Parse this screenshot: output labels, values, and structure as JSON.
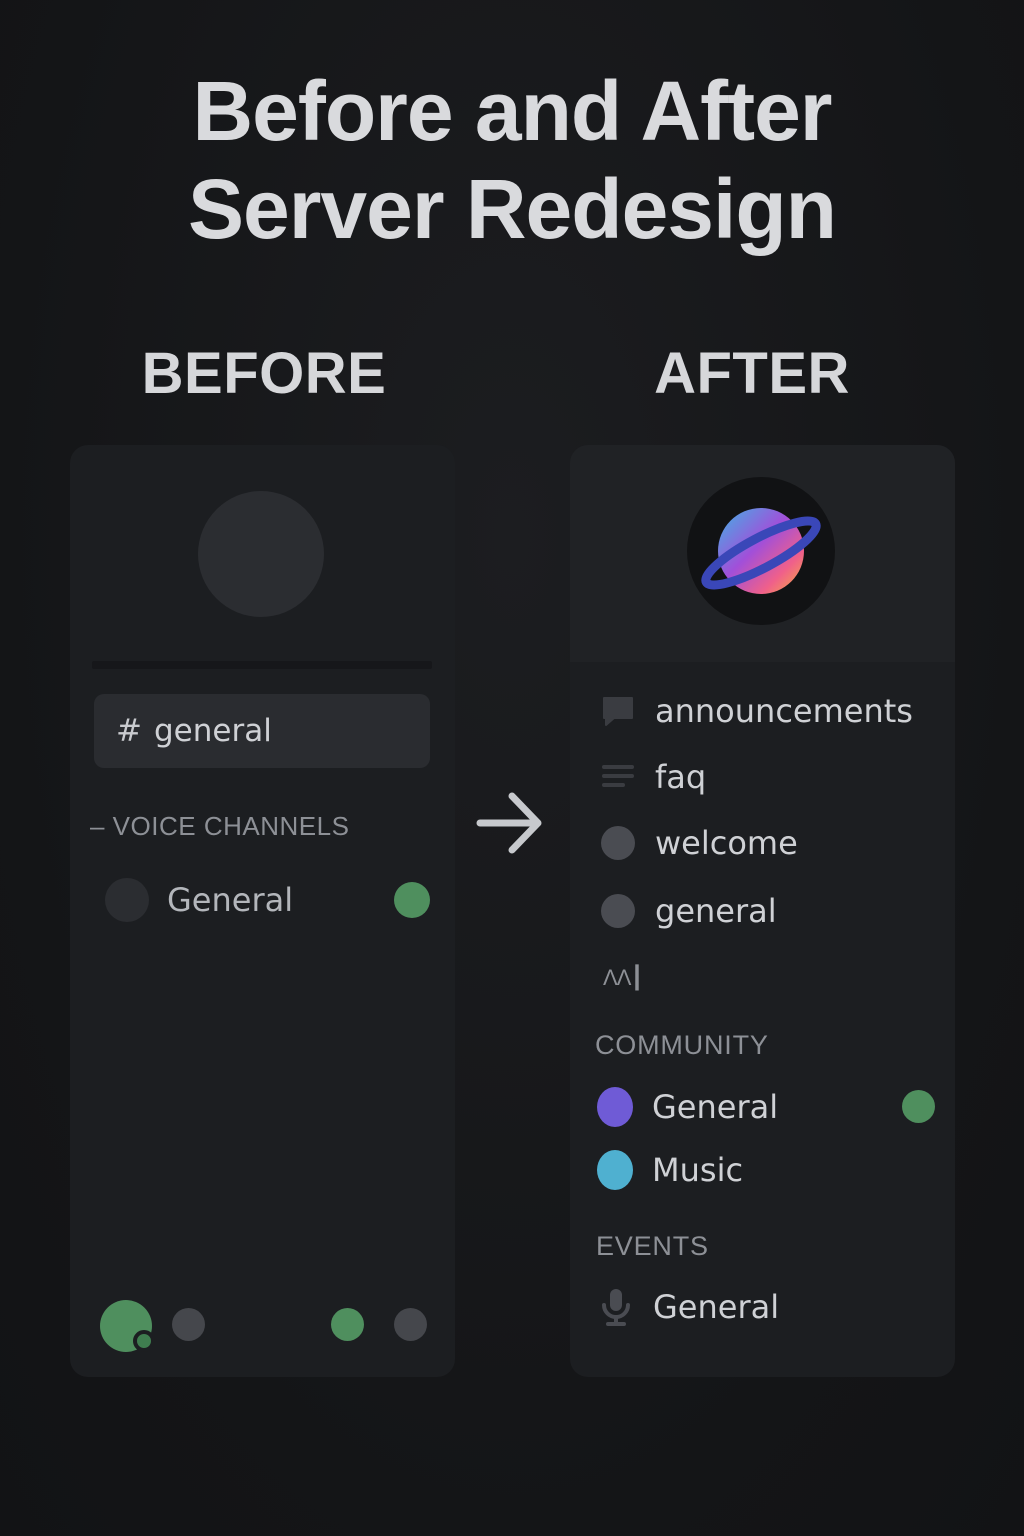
{
  "title_line1": "Before and After",
  "title_line2": "Server Redesign",
  "before": {
    "heading": "BEFORE",
    "text_channel": {
      "hash": "#",
      "name": "general"
    },
    "section_label": "– VOICE CHANNELS",
    "voice_channel": {
      "name": "General",
      "status": "online"
    }
  },
  "after": {
    "heading": "AFTER",
    "channels": [
      {
        "icon": "speech-bubble-icon",
        "name": "announcements"
      },
      {
        "icon": "lines-icon",
        "name": "faq"
      },
      {
        "icon": "circle-icon",
        "name": "welcome"
      },
      {
        "icon": "circle-icon",
        "name": "general"
      }
    ],
    "misc_glyph": "ΛΛ┃",
    "community_label": "COMMUNITY",
    "community": [
      {
        "name": "General",
        "color": "#6f5bd6",
        "status": "online"
      },
      {
        "name": "Music",
        "color": "#4fb0d0"
      }
    ],
    "events_label": "EVENTS",
    "events": [
      {
        "icon": "microphone-icon",
        "name": "General"
      }
    ]
  },
  "colors": {
    "background": "#151618",
    "panel": "#1c1e21",
    "online_green": "#4f8f5e",
    "muted_text": "#8d9096"
  }
}
